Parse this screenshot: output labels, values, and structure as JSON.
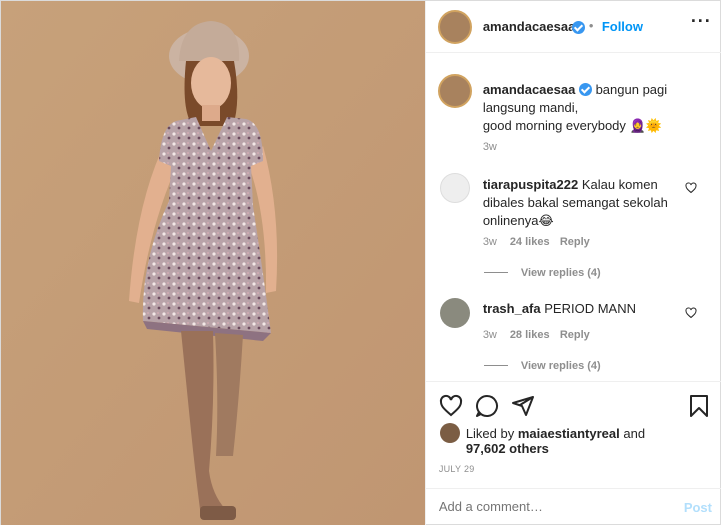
{
  "post": {
    "username": "amandacaesaa",
    "follow_label": "Follow",
    "header_bullet": "•"
  },
  "caption": {
    "username": "amandacaesaa",
    "text_line1": "bangun pagi",
    "text_line2": "langsung mandi,",
    "text_line3": "good morning everybody 🧕🌞",
    "time": "3w"
  },
  "comments": [
    {
      "username": "tiarapuspita222",
      "text_line1": "Kalau komen",
      "text_line2": "dibales bakal semangat sekolah",
      "text_line3": "onlinenya😂",
      "time": "3w",
      "likes": "24 likes",
      "reply_label": "Reply",
      "view_replies": "View replies (4)"
    },
    {
      "username": "trash_afa",
      "text_line1": "PERIOD MANN",
      "time": "3w",
      "likes": "28 likes",
      "reply_label": "Reply",
      "view_replies": "View replies (4)"
    }
  ],
  "likes": {
    "prefix": "Liked by",
    "liker": "maiaestiantyreal",
    "and": "and",
    "others": "97,602 others"
  },
  "date": "JULY 29",
  "add_comment": {
    "placeholder": "Add a comment…",
    "post_label": "Post"
  },
  "icons": {
    "header_more": "more-icon",
    "like": "heart-icon",
    "comment": "comment-icon",
    "share": "share-icon",
    "save": "bookmark-icon"
  },
  "colors": {
    "accent": "#0095f6",
    "verified": "#3897f0",
    "photo_bg": "#c6a079"
  }
}
